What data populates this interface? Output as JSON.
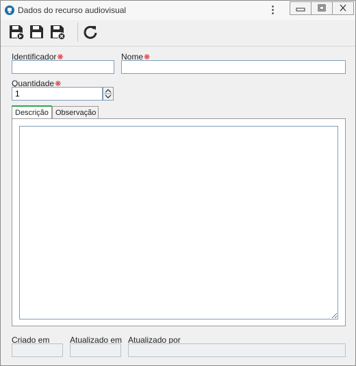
{
  "window": {
    "title": "Dados do recurso audiovisual",
    "menu_glyph": "⋮"
  },
  "toolbar": {
    "buttons": [
      {
        "name": "save-and-new",
        "icon": "save-plus-icon"
      },
      {
        "name": "save",
        "icon": "save-icon"
      },
      {
        "name": "save-and-close",
        "icon": "save-close-icon"
      },
      {
        "name": "refresh",
        "icon": "refresh-icon"
      }
    ]
  },
  "form": {
    "identificador_label": "Identificador",
    "identificador_value": "",
    "nome_label": "Nome",
    "nome_value": "",
    "quantidade_label": "Quantidade",
    "quantidade_value": "1",
    "required_marker": "❋"
  },
  "tabs": [
    {
      "label": "Descrição",
      "active": true
    },
    {
      "label": "Observação",
      "active": false
    }
  ],
  "descricao_value": "",
  "footer": {
    "criado_em_label": "Criado em",
    "criado_em_value": "",
    "atualizado_em_label": "Atualizado em",
    "atualizado_em_value": "",
    "atualizado_por_label": "Atualizado por",
    "atualizado_por_value": ""
  },
  "colors": {
    "accent": "#2ea84a",
    "required": "#d9232a",
    "input_border": "#7f9db9",
    "toolbar_icon": "#2b2b2b"
  }
}
